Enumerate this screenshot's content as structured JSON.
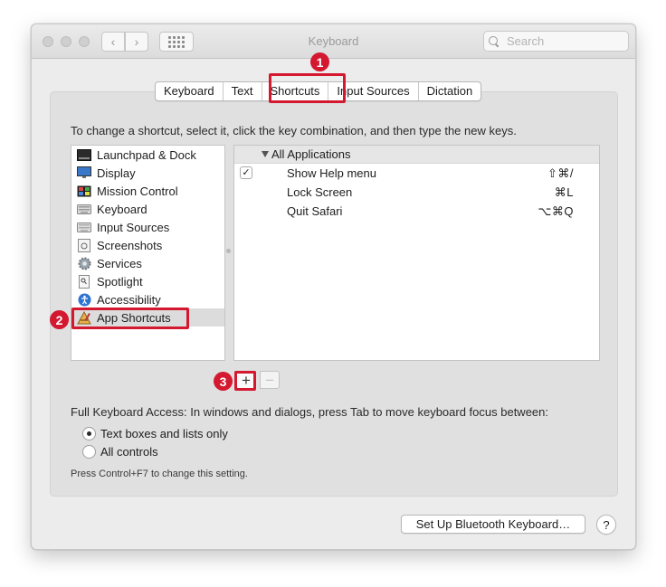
{
  "window": {
    "title": "Keyboard",
    "search_placeholder": "Search"
  },
  "tabs": [
    {
      "label": "Keyboard",
      "selected": false
    },
    {
      "label": "Text",
      "selected": false
    },
    {
      "label": "Shortcuts",
      "selected": true
    },
    {
      "label": "Input Sources",
      "selected": false
    },
    {
      "label": "Dictation",
      "selected": false
    }
  ],
  "instruction": "To change a shortcut, select it, click the key combination, and then type the new keys.",
  "categories": [
    {
      "label": "Launchpad & Dock",
      "icon": "launchpad-icon"
    },
    {
      "label": "Display",
      "icon": "display-icon"
    },
    {
      "label": "Mission Control",
      "icon": "mission-control-icon"
    },
    {
      "label": "Keyboard",
      "icon": "keyboard-icon"
    },
    {
      "label": "Input Sources",
      "icon": "input-sources-icon"
    },
    {
      "label": "Screenshots",
      "icon": "screenshots-icon"
    },
    {
      "label": "Services",
      "icon": "gear-icon"
    },
    {
      "label": "Spotlight",
      "icon": "spotlight-icon"
    },
    {
      "label": "Accessibility",
      "icon": "accessibility-icon"
    },
    {
      "label": "App Shortcuts",
      "icon": "app-shortcuts-icon",
      "selected": true
    }
  ],
  "shortcuts": {
    "group": "All Applications",
    "rows": [
      {
        "name": "Show Help menu",
        "keys": "⇧⌘/",
        "checked": true
      },
      {
        "name": "Lock Screen",
        "keys": "⌘L",
        "checked": false
      },
      {
        "name": "Quit Safari",
        "keys": "⌥⌘Q",
        "checked": false
      }
    ]
  },
  "buttons": {
    "add": "+",
    "remove": "−",
    "bluetooth": "Set Up Bluetooth Keyboard…",
    "help": "?"
  },
  "full_keyboard_access": {
    "label": "Full Keyboard Access: In windows and dialogs, press Tab to move keyboard focus between:",
    "options": [
      {
        "label": "Text boxes and lists only",
        "selected": true
      },
      {
        "label": "All controls",
        "selected": false
      }
    ],
    "hint": "Press Control+F7 to change this setting."
  },
  "annotations": {
    "one": "1",
    "two": "2",
    "three": "3",
    "color": "#d3182f"
  },
  "colors": {
    "window_bg": "#ececec",
    "panel_bg": "#e0e0e0",
    "selection": "#dcdcdc"
  }
}
